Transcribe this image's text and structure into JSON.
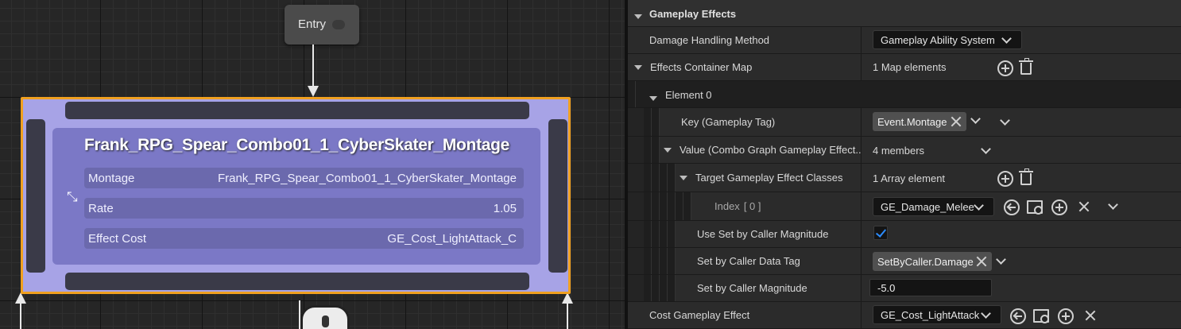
{
  "graph": {
    "entry_node": {
      "label": "Entry"
    },
    "montage_node": {
      "title": "Frank_RPG_Spear_Combo01_1_CyberSkater_Montage",
      "accent_color": "#f0a020",
      "body_color": "#a7a3e6",
      "properties": [
        {
          "key": "Montage",
          "value": "Frank_RPG_Spear_Combo01_1_CyberSkater_Montage"
        },
        {
          "key": "Rate",
          "value": "1.05"
        },
        {
          "key": "Effect Cost",
          "value": "GE_Cost_LightAttack_C"
        }
      ]
    }
  },
  "details": {
    "category": "Gameplay Effects",
    "damage_handling": {
      "label": "Damage Handling Method",
      "value": "Gameplay Ability System"
    },
    "effects_container_map": {
      "label": "Effects Container Map",
      "value": "1 Map elements"
    },
    "element0": {
      "label": "Element 0"
    },
    "key": {
      "label": "Key (Gameplay Tag)",
      "tag": "Event.Montage"
    },
    "value_struct": {
      "label": "Value (Combo Graph Gameplay Effect...",
      "value": "4 members"
    },
    "target_classes": {
      "label": "Target Gameplay Effect Classes",
      "value": "1 Array element"
    },
    "index0": {
      "label": "Index",
      "index": "[ 0 ]",
      "value": "GE_Damage_Melee"
    },
    "use_set_by_caller": {
      "label": "Use Set by Caller Magnitude",
      "checked": true
    },
    "set_by_caller_tag": {
      "label": "Set by Caller Data Tag",
      "tag": "SetByCaller.Damage"
    },
    "set_by_caller_magnitude": {
      "label": "Set by Caller Magnitude",
      "value": "-5.0"
    },
    "cost_effect": {
      "label": "Cost Gameplay Effect",
      "value": "GE_Cost_LightAttack"
    }
  }
}
